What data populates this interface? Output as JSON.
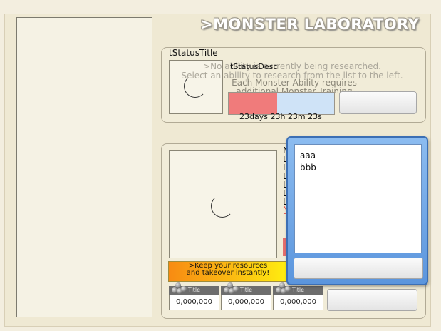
{
  "header": {
    "title": ">MONSTER LABORATORY"
  },
  "status": {
    "title": "tStatusTitle",
    "desc": "tStatusDesc",
    "no_ability_line1": ">No ability is currently being researched.",
    "no_ability_line2": "Select an ability to research from the list to the left.",
    "requires_line1": "Each Monster Ability requires",
    "requires_line2": "additional Monster Training",
    "progress_fraction": 0.46,
    "time_remaining": "23days 23h 23m 23s",
    "progress_colors": {
      "fill": "#f07b7b",
      "track": "#cfe3f7"
    }
  },
  "details": {
    "stat_letters": [
      "N",
      "D",
      "L",
      "L",
      "L",
      "L",
      "L"
    ],
    "stat_red": [
      "N",
      "D"
    ],
    "promo_line1": ">Keep your resources",
    "promo_line2": "and takeover instantly!",
    "resources": [
      {
        "title": "Title",
        "value": "0,000,000"
      },
      {
        "title": "Title",
        "value": "0,000,000"
      },
      {
        "title": "Title",
        "value": "0,000,000"
      }
    ]
  },
  "popup": {
    "items": [
      "aaa",
      "bbb"
    ]
  }
}
